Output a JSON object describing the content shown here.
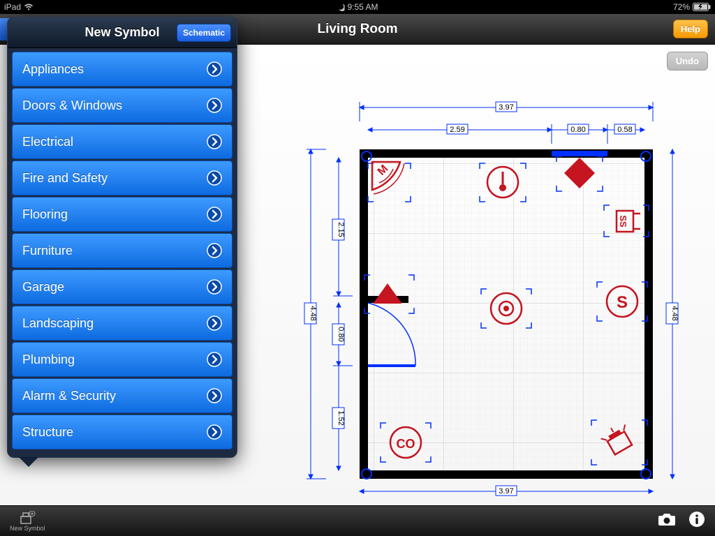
{
  "status": {
    "device": "iPad",
    "time": "9:55 AM",
    "battery": "72%"
  },
  "nav": {
    "title": "Living Room",
    "help": "Help"
  },
  "content": {
    "undo": "Undo"
  },
  "bottom": {
    "new_symbol": "New Symbol"
  },
  "popover": {
    "title": "New Symbol",
    "schematic": "Schematic",
    "items": [
      {
        "label": "Appliances"
      },
      {
        "label": "Doors & Windows"
      },
      {
        "label": "Electrical"
      },
      {
        "label": "Fire and Safety"
      },
      {
        "label": "Flooring"
      },
      {
        "label": "Furniture"
      },
      {
        "label": "Garage"
      },
      {
        "label": "Landscaping"
      },
      {
        "label": "Plumbing"
      },
      {
        "label": "Alarm & Security"
      },
      {
        "label": "Structure"
      }
    ]
  },
  "dimensions": {
    "top_outer": "3.97",
    "bottom_outer": "3.97",
    "top_seg1": "2.59",
    "top_seg2": "0.80",
    "top_seg3": "0.58",
    "right_outer": "4.48",
    "left_outer": "4.48",
    "left_seg1": "2.15",
    "left_seg2": "0.80",
    "left_seg3": "1.52"
  },
  "symbols": {
    "motion": "M",
    "strobe": "SS",
    "smoke": "S",
    "co": "CO"
  }
}
